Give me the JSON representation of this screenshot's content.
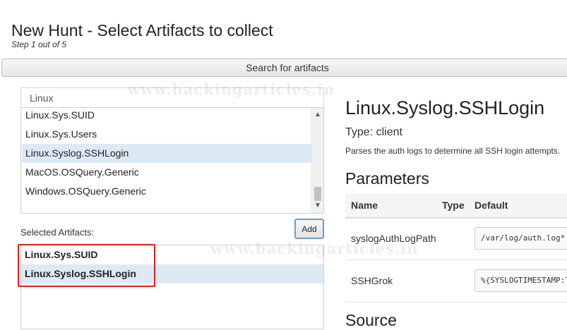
{
  "header": {
    "title": "New Hunt - Select Artifacts to collect",
    "step": "Step 1 out of 5"
  },
  "search_tab": {
    "label": "Search for artifacts"
  },
  "watermark": "www.hackingarticles.in",
  "search": {
    "value": "Linux"
  },
  "artifact_list": {
    "items": [
      {
        "label": "Linux.Sys.SUID",
        "selected": false
      },
      {
        "label": "Linux.Sys.Users",
        "selected": false
      },
      {
        "label": "Linux.Syslog.SSHLogin",
        "selected": true
      },
      {
        "label": "MacOS.OSQuery.Generic",
        "selected": false
      },
      {
        "label": "Windows.OSQuery.Generic",
        "selected": false
      }
    ]
  },
  "selected_artifacts": {
    "label": "Selected Artifacts:",
    "add_label": "Add",
    "items": [
      {
        "label": "Linux.Sys.SUID"
      },
      {
        "label": "Linux.Syslog.SSHLogin"
      }
    ]
  },
  "detail": {
    "name": "Linux.Syslog.SSHLogin",
    "type": "Type: client",
    "description": "Parses the auth logs to determine all SSH login attempts.",
    "parameters_heading": "Parameters",
    "columns": {
      "name": "Name",
      "type": "Type",
      "default": "Default"
    },
    "parameters": [
      {
        "name": "syslogAuthLogPath",
        "default": "/var/log/auth.log*"
      },
      {
        "name": "SSHGrok",
        "default": "%{SYSLOGTIMESTAMP:Timestamp}"
      }
    ],
    "source_heading": "Source"
  },
  "colors": {
    "highlight": "#e02020",
    "selected_row": "#dde9f5",
    "add_border": "#6d9bc3"
  }
}
